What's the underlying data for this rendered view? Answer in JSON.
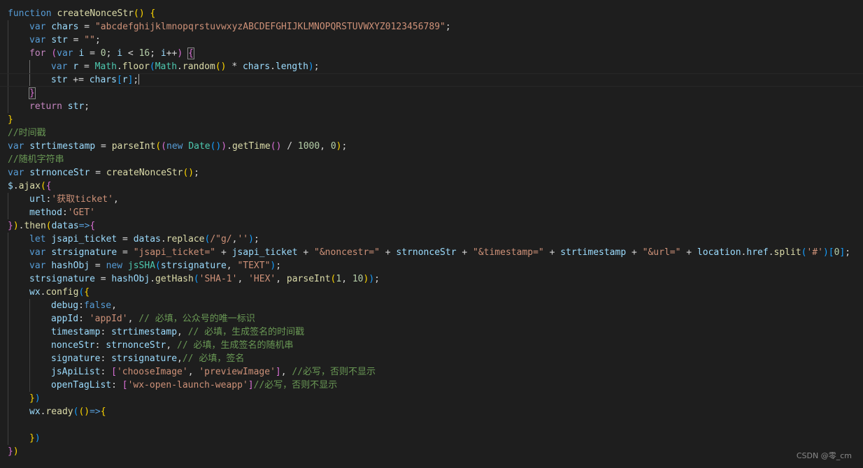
{
  "theme": {
    "background": "#1e1e1e",
    "default": "#d4d4d4",
    "keyword": "#569cd6",
    "control": "#c586c0",
    "function": "#dcdcaa",
    "variable": "#9cdcfe",
    "type": "#4ec9b0",
    "string": "#ce9178",
    "number": "#b5cea8",
    "comment": "#6a9955",
    "bracket1": "#ffd700",
    "bracket2": "#da70d6",
    "bracket3": "#179fff"
  },
  "editor": {
    "active_line_index": 5,
    "lines": [
      {
        "indent": 0,
        "tokens": [
          [
            "function",
            "kw"
          ],
          [
            " ",
            ""
          ],
          [
            "createNonceStr",
            "fn"
          ],
          [
            "(",
            "b1"
          ],
          [
            ")",
            "b1"
          ],
          [
            " ",
            ""
          ],
          [
            "{",
            "b1"
          ]
        ]
      },
      {
        "indent": 1,
        "tokens": [
          [
            "var",
            "kw"
          ],
          [
            " ",
            ""
          ],
          [
            "chars",
            "var"
          ],
          [
            " = ",
            ""
          ],
          [
            "\"abcdefghijklmnopqrstuvwxyzABCDEFGHIJKLMNOPQRSTUVWXYZ0123456789\"",
            "str"
          ],
          [
            ";",
            ""
          ]
        ]
      },
      {
        "indent": 1,
        "tokens": [
          [
            "var",
            "kw"
          ],
          [
            " ",
            ""
          ],
          [
            "str",
            "var"
          ],
          [
            " = ",
            ""
          ],
          [
            "\"\"",
            "str"
          ],
          [
            ";",
            ""
          ]
        ]
      },
      {
        "indent": 1,
        "tokens": [
          [
            "for",
            "ctl"
          ],
          [
            " ",
            ""
          ],
          [
            "(",
            "b2"
          ],
          [
            "var",
            "kw"
          ],
          [
            " ",
            ""
          ],
          [
            "i",
            "var"
          ],
          [
            " = ",
            ""
          ],
          [
            "0",
            "num"
          ],
          [
            "; ",
            ""
          ],
          [
            "i",
            "var"
          ],
          [
            " < ",
            ""
          ],
          [
            "16",
            "num"
          ],
          [
            "; ",
            ""
          ],
          [
            "i",
            "var"
          ],
          [
            "++",
            ""
          ],
          [
            ")",
            "b2"
          ],
          [
            " ",
            ""
          ],
          [
            "{",
            "b2",
            "bm"
          ]
        ]
      },
      {
        "indent": 2,
        "tokens": [
          [
            "var",
            "kw"
          ],
          [
            " ",
            ""
          ],
          [
            "r",
            "var"
          ],
          [
            " = ",
            ""
          ],
          [
            "Math",
            "type"
          ],
          [
            ".",
            ""
          ],
          [
            "floor",
            "fn"
          ],
          [
            "(",
            "b3"
          ],
          [
            "Math",
            "type"
          ],
          [
            ".",
            ""
          ],
          [
            "random",
            "fn"
          ],
          [
            "(",
            "b1"
          ],
          [
            ")",
            "b1"
          ],
          [
            " * ",
            ""
          ],
          [
            "chars",
            "var"
          ],
          [
            ".",
            ""
          ],
          [
            "length",
            "var"
          ],
          [
            ")",
            "b3"
          ],
          [
            ";",
            ""
          ]
        ]
      },
      {
        "indent": 2,
        "tokens": [
          [
            "str",
            "var"
          ],
          [
            " += ",
            ""
          ],
          [
            "chars",
            "var"
          ],
          [
            "[",
            "b3"
          ],
          [
            "r",
            "var"
          ],
          [
            "]",
            "b3"
          ],
          [
            ";",
            ""
          ]
        ],
        "caret": true
      },
      {
        "indent": 1,
        "tokens": [
          [
            "}",
            "b2",
            "bm"
          ]
        ]
      },
      {
        "indent": 1,
        "tokens": [
          [
            "return",
            "ctl"
          ],
          [
            " ",
            ""
          ],
          [
            "str",
            "var"
          ],
          [
            ";",
            ""
          ]
        ]
      },
      {
        "indent": 0,
        "tokens": [
          [
            "}",
            "b1"
          ]
        ]
      },
      {
        "indent": 0,
        "tokens": [
          [
            "//时间戳",
            "cmt"
          ]
        ]
      },
      {
        "indent": 0,
        "tokens": [
          [
            "var",
            "kw"
          ],
          [
            " ",
            ""
          ],
          [
            "strtimestamp",
            "var"
          ],
          [
            " = ",
            ""
          ],
          [
            "parseInt",
            "fn"
          ],
          [
            "(",
            "b1"
          ],
          [
            "(",
            "b2"
          ],
          [
            "new",
            "kw"
          ],
          [
            " ",
            ""
          ],
          [
            "Date",
            "type"
          ],
          [
            "(",
            "b3"
          ],
          [
            ")",
            "b3"
          ],
          [
            ")",
            "b2"
          ],
          [
            ".",
            ""
          ],
          [
            "getTime",
            "fn"
          ],
          [
            "(",
            "b2"
          ],
          [
            ")",
            "b2"
          ],
          [
            " / ",
            ""
          ],
          [
            "1000",
            "num"
          ],
          [
            ", ",
            ""
          ],
          [
            "0",
            "num"
          ],
          [
            ")",
            "b1"
          ],
          [
            ";",
            ""
          ]
        ]
      },
      {
        "indent": 0,
        "tokens": [
          [
            "//随机字符串",
            "cmt"
          ]
        ]
      },
      {
        "indent": 0,
        "tokens": [
          [
            "var",
            "kw"
          ],
          [
            " ",
            ""
          ],
          [
            "strnonceStr",
            "var"
          ],
          [
            " = ",
            ""
          ],
          [
            "createNonceStr",
            "fn"
          ],
          [
            "(",
            "b1"
          ],
          [
            ")",
            "b1"
          ],
          [
            ";",
            ""
          ]
        ]
      },
      {
        "indent": 0,
        "tokens": [
          [
            "$",
            "var"
          ],
          [
            ".",
            ""
          ],
          [
            "ajax",
            "fn"
          ],
          [
            "(",
            "b1"
          ],
          [
            "{",
            "b2"
          ]
        ]
      },
      {
        "indent": 1,
        "tokens": [
          [
            "url",
            "var"
          ],
          [
            ":",
            ""
          ],
          [
            "'获取ticket'",
            "str"
          ],
          [
            ",",
            ""
          ]
        ]
      },
      {
        "indent": 1,
        "tokens": [
          [
            "method",
            "var"
          ],
          [
            ":",
            ""
          ],
          [
            "'GET'",
            "str"
          ]
        ]
      },
      {
        "indent": 0,
        "tokens": [
          [
            "}",
            "b2"
          ],
          [
            ")",
            "b1"
          ],
          [
            ".",
            ""
          ],
          [
            "then",
            "fn"
          ],
          [
            "(",
            "b1"
          ],
          [
            "datas",
            "var"
          ],
          [
            "=>",
            "kw"
          ],
          [
            "{",
            "b2"
          ]
        ]
      },
      {
        "indent": 1,
        "tokens": [
          [
            "let",
            "kw"
          ],
          [
            " ",
            ""
          ],
          [
            "jsapi_ticket",
            "var"
          ],
          [
            " = ",
            ""
          ],
          [
            "datas",
            "var"
          ],
          [
            ".",
            ""
          ],
          [
            "replace",
            "fn"
          ],
          [
            "(",
            "b3"
          ],
          [
            "/\"g/",
            "str"
          ],
          [
            ",",
            ""
          ],
          [
            "''",
            "str"
          ],
          [
            ")",
            "b3"
          ],
          [
            ";",
            ""
          ]
        ]
      },
      {
        "indent": 1,
        "tokens": [
          [
            "var",
            "kw"
          ],
          [
            " ",
            ""
          ],
          [
            "strsignature",
            "var"
          ],
          [
            " = ",
            ""
          ],
          [
            "\"jsapi_ticket=\"",
            "str"
          ],
          [
            " + ",
            ""
          ],
          [
            "jsapi_ticket",
            "var"
          ],
          [
            " + ",
            ""
          ],
          [
            "\"&noncestr=\"",
            "str"
          ],
          [
            " + ",
            ""
          ],
          [
            "strnonceStr",
            "var"
          ],
          [
            " + ",
            ""
          ],
          [
            "\"&timestamp=\"",
            "str"
          ],
          [
            " + ",
            ""
          ],
          [
            "strtimestamp",
            "var"
          ],
          [
            " + ",
            ""
          ],
          [
            "\"&url=\"",
            "str"
          ],
          [
            " + ",
            ""
          ],
          [
            "location",
            "var"
          ],
          [
            ".",
            ""
          ],
          [
            "href",
            "var"
          ],
          [
            ".",
            ""
          ],
          [
            "split",
            "fn"
          ],
          [
            "(",
            "b3"
          ],
          [
            "'#'",
            "str"
          ],
          [
            ")",
            "b3"
          ],
          [
            "[",
            "b3"
          ],
          [
            "0",
            "num"
          ],
          [
            "]",
            "b3"
          ],
          [
            ";",
            ""
          ]
        ]
      },
      {
        "indent": 1,
        "tokens": [
          [
            "var",
            "kw"
          ],
          [
            " ",
            ""
          ],
          [
            "hashObj",
            "var"
          ],
          [
            " = ",
            ""
          ],
          [
            "new",
            "kw"
          ],
          [
            " ",
            ""
          ],
          [
            "jsSHA",
            "type"
          ],
          [
            "(",
            "b3"
          ],
          [
            "strsignature",
            "var"
          ],
          [
            ", ",
            ""
          ],
          [
            "\"TEXT\"",
            "str"
          ],
          [
            ")",
            "b3"
          ],
          [
            ";",
            ""
          ]
        ]
      },
      {
        "indent": 1,
        "tokens": [
          [
            "strsignature",
            "var"
          ],
          [
            " = ",
            ""
          ],
          [
            "hashObj",
            "var"
          ],
          [
            ".",
            ""
          ],
          [
            "getHash",
            "fn"
          ],
          [
            "(",
            "b3"
          ],
          [
            "'SHA-1'",
            "str"
          ],
          [
            ", ",
            ""
          ],
          [
            "'HEX'",
            "str"
          ],
          [
            ", ",
            ""
          ],
          [
            "parseInt",
            "fn"
          ],
          [
            "(",
            "b1"
          ],
          [
            "1",
            "num"
          ],
          [
            ", ",
            ""
          ],
          [
            "10",
            "num"
          ],
          [
            ")",
            "b1"
          ],
          [
            ")",
            "b3"
          ],
          [
            ";",
            ""
          ]
        ]
      },
      {
        "indent": 1,
        "tokens": [
          [
            "wx",
            "var"
          ],
          [
            ".",
            ""
          ],
          [
            "config",
            "fn"
          ],
          [
            "(",
            "b3"
          ],
          [
            "{",
            "b1"
          ]
        ]
      },
      {
        "indent": 2,
        "tokens": [
          [
            "debug",
            "var"
          ],
          [
            ":",
            ""
          ],
          [
            "false",
            "kw"
          ],
          [
            ",",
            ""
          ]
        ]
      },
      {
        "indent": 2,
        "tokens": [
          [
            "appId",
            "var"
          ],
          [
            ": ",
            ""
          ],
          [
            "'appId'",
            "str"
          ],
          [
            ", ",
            ""
          ],
          [
            "// 必填，公众号的唯一标识",
            "cmt"
          ]
        ]
      },
      {
        "indent": 2,
        "tokens": [
          [
            "timestamp",
            "var"
          ],
          [
            ": ",
            ""
          ],
          [
            "strtimestamp",
            "var"
          ],
          [
            ", ",
            ""
          ],
          [
            "// 必填，生成签名的时间戳",
            "cmt"
          ]
        ]
      },
      {
        "indent": 2,
        "tokens": [
          [
            "nonceStr",
            "var"
          ],
          [
            ": ",
            ""
          ],
          [
            "strnonceStr",
            "var"
          ],
          [
            ", ",
            ""
          ],
          [
            "// 必填，生成签名的随机串",
            "cmt"
          ]
        ]
      },
      {
        "indent": 2,
        "tokens": [
          [
            "signature",
            "var"
          ],
          [
            ": ",
            ""
          ],
          [
            "strsignature",
            "var"
          ],
          [
            ",",
            ""
          ],
          [
            "// 必填，签名",
            "cmt"
          ]
        ]
      },
      {
        "indent": 2,
        "tokens": [
          [
            "jsApiList",
            "var"
          ],
          [
            ": ",
            ""
          ],
          [
            "[",
            "b2"
          ],
          [
            "'chooseImage'",
            "str"
          ],
          [
            ", ",
            ""
          ],
          [
            "'previewImage'",
            "str"
          ],
          [
            "]",
            "b2"
          ],
          [
            ", ",
            ""
          ],
          [
            "//必写，否则不显示",
            "cmt"
          ]
        ]
      },
      {
        "indent": 2,
        "tokens": [
          [
            "openTagList",
            "var"
          ],
          [
            ": ",
            ""
          ],
          [
            "[",
            "b2"
          ],
          [
            "'wx-open-launch-weapp'",
            "str"
          ],
          [
            "]",
            "b2"
          ],
          [
            "//必写，否则不显示",
            "cmt"
          ]
        ]
      },
      {
        "indent": 1,
        "tokens": [
          [
            "}",
            "b1"
          ],
          [
            ")",
            "b3"
          ]
        ]
      },
      {
        "indent": 1,
        "tokens": [
          [
            "wx",
            "var"
          ],
          [
            ".",
            ""
          ],
          [
            "ready",
            "fn"
          ],
          [
            "(",
            "b3"
          ],
          [
            "(",
            "b1"
          ],
          [
            ")",
            "b1"
          ],
          [
            "=>",
            "kw"
          ],
          [
            "{",
            "b1"
          ]
        ]
      },
      {
        "indent": 0,
        "tokens": []
      },
      {
        "indent": 1,
        "tokens": [
          [
            "}",
            "b1"
          ],
          [
            ")",
            "b3"
          ]
        ]
      },
      {
        "indent": 0,
        "tokens": [
          [
            "}",
            "b2"
          ],
          [
            ")",
            "b1"
          ]
        ]
      }
    ]
  },
  "watermark": "CSDN @零_cm"
}
